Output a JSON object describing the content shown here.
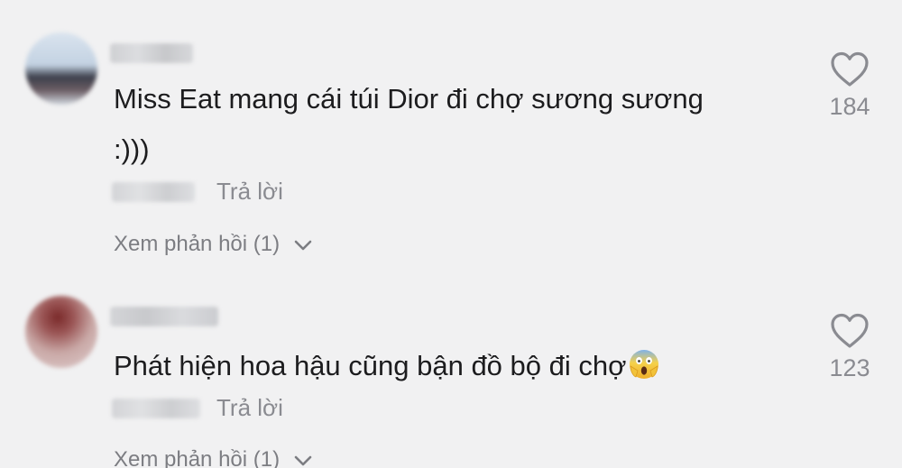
{
  "comments": [
    {
      "text": "Miss Eat mang cái túi Dior đi chợ sương sương :)))",
      "reply_label": "Trả lời",
      "view_replies_label": "Xem phản hồi (1)",
      "like_count": "184",
      "avatar_icon": "blurred-avatar",
      "has_emoji": false
    },
    {
      "text": "Phát hiện hoa hậu cũng bận đồ bộ đi chợ",
      "reply_label": "Trả lời",
      "view_replies_label": "Xem phản hồi (1)",
      "like_count": "123",
      "avatar_icon": "blurred-avatar",
      "has_emoji": true,
      "emoji_icon": "face-screaming-in-fear-icon"
    }
  ],
  "colors": {
    "background": "#f1f1f2",
    "text": "#1c1c1e",
    "muted": "#8a8b91"
  }
}
